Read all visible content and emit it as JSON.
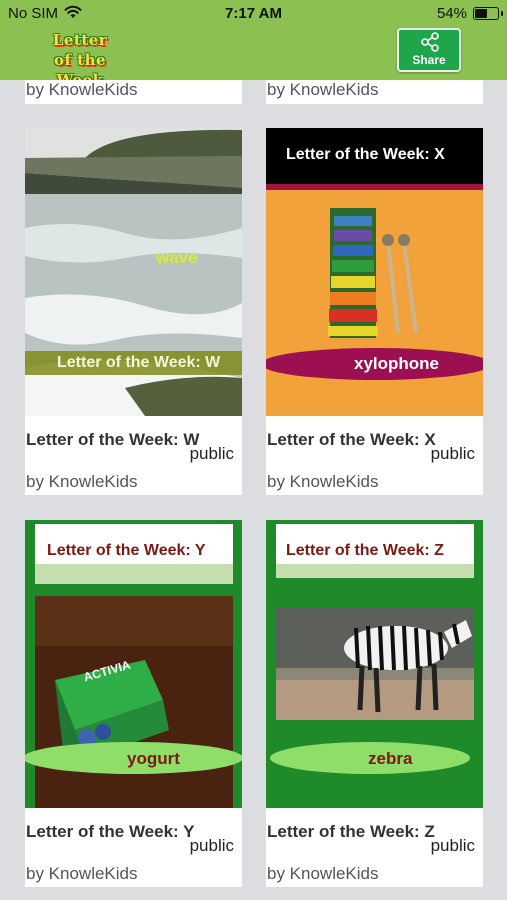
{
  "status_bar": {
    "carrier": "No SIM",
    "time": "7:17 AM",
    "battery_percent": "54%",
    "battery_level": 0.54
  },
  "nav": {
    "logo_line1": "Letter",
    "logo_line2": "of the Week",
    "share_label": "Share"
  },
  "top_row": [
    {
      "author": "by KnowleKids"
    },
    {
      "author": "by KnowleKids"
    }
  ],
  "cards": [
    {
      "title": "Letter of the Week: W",
      "visibility": "public",
      "author": "by KnowleKids",
      "thumb_word": "wave",
      "thumb_caption": "Letter of the Week: W"
    },
    {
      "title": "Letter of the Week: X",
      "visibility": "public",
      "author": "by KnowleKids",
      "thumb_word": "xylophone",
      "thumb_caption": "Letter of the Week: X"
    },
    {
      "title": "Letter of the Week: Y",
      "visibility": "public",
      "author": "by KnowleKids",
      "thumb_word": "yogurt",
      "thumb_caption": "Letter of the Week: Y",
      "product_text": "ACTIVIA"
    },
    {
      "title": "Letter of the Week: Z",
      "visibility": "public",
      "author": "by KnowleKids",
      "thumb_word": "zebra",
      "thumb_caption": "Letter of the Week: Z"
    }
  ],
  "colors": {
    "nav_green": "#8cc152",
    "share_green": "#1fa64a",
    "background": "#dcdde0"
  }
}
